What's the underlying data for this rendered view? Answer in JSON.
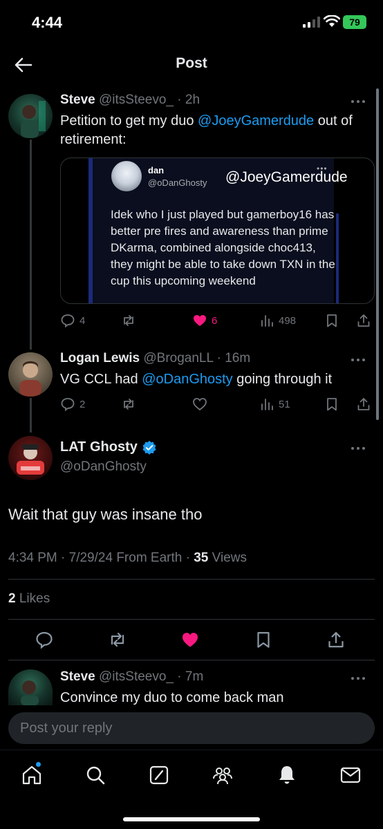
{
  "status_bar": {
    "time": "4:44",
    "battery": "79"
  },
  "header": {
    "title": "Post"
  },
  "thread": [
    {
      "name": "Steve",
      "handle": "@itsSteevo_",
      "time": "· 2h",
      "text_before": "Petition to get my duo ",
      "mention": "@JoeyGamerdude",
      "text_after": " out of retirement:",
      "quote": {
        "name": "dan",
        "handle": "@oDanGhosty",
        "mention": "@JoeyGamerdude",
        "dots": "•••",
        "text": "Idek who I just played but gamerboy16 has better pre fires and awareness than prime DKarma, combined alongside choc413, they might be able to take down TXN in the cup this upcoming weekend"
      },
      "stats": {
        "replies": "4",
        "likes": "6",
        "views": "498"
      }
    },
    {
      "name": "Logan Lewis",
      "handle": "@BroganLL",
      "time": "· 16m",
      "text_before": "VG CCL had ",
      "mention": "@oDanGhosty",
      "text_after": " going through it",
      "stats": {
        "replies": "2",
        "likes": "",
        "views": "51"
      }
    }
  ],
  "main_post": {
    "name": "LAT Ghosty",
    "handle": "@oDanGhosty",
    "text": "Wait that guy was insane tho",
    "meta_prefix": "4:34 PM · 7/29/24 From Earth · ",
    "views_count": "35",
    "views_label": " Views",
    "likes_count": "2",
    "likes_label": " Likes"
  },
  "reply_preview": {
    "name": "Steve",
    "handle": "@itsSteevo_",
    "time": "· 7m",
    "text": "Convince my duo to come back man"
  },
  "reply_box": {
    "placeholder": "Post your reply"
  },
  "colors": {
    "accent": "#1d9bf0",
    "like": "#f91880",
    "muted": "#71767b"
  },
  "icons": [
    "back-arrow-icon",
    "reply-icon",
    "repost-icon",
    "heart-icon",
    "views-icon",
    "bookmark-icon",
    "share-icon",
    "verified-badge-icon",
    "home-icon",
    "search-icon",
    "grok-icon",
    "communities-icon",
    "notifications-icon",
    "messages-icon"
  ]
}
